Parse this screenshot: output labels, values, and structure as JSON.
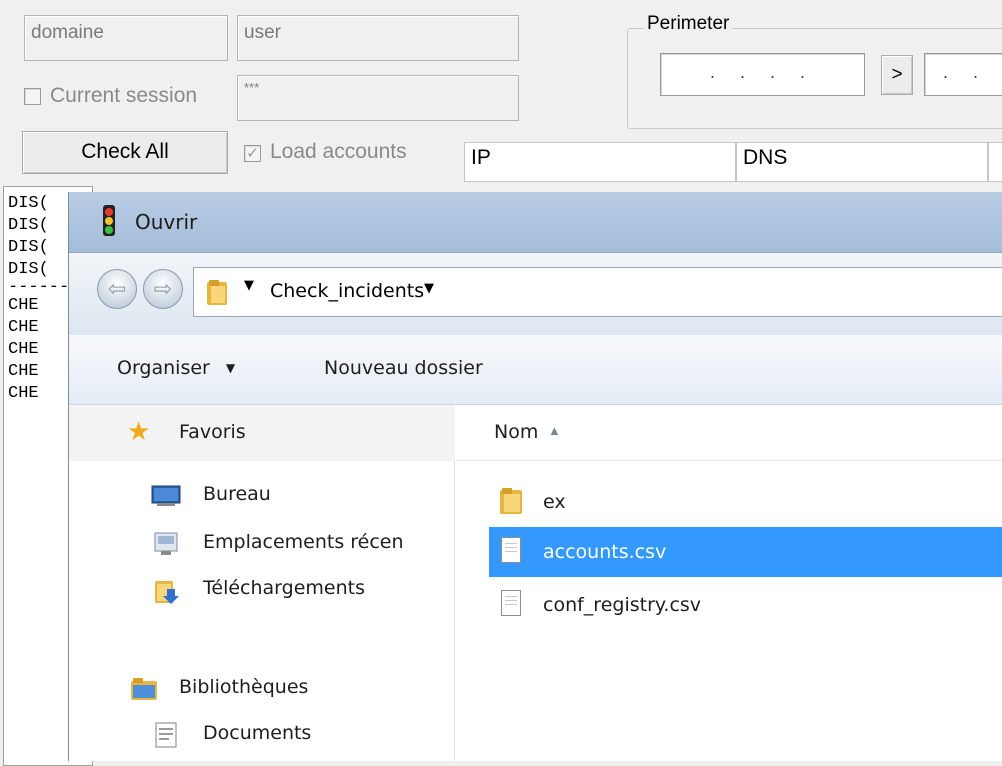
{
  "app": {
    "domain_field": "domaine",
    "user_field": "user",
    "password_field": "***",
    "current_session_label": "Current session",
    "check_all_button": "Check All",
    "load_accounts_label": "Load accounts",
    "perimeter_title": "Perimeter",
    "ip_start_value": ". . . .",
    "ip_end_value": ". .",
    "perimeter_next_button": ">",
    "columns": [
      "IP",
      "DNS"
    ],
    "log_lines": [
      "DIS(",
      "DIS(",
      "DIS(",
      "DIS(",
      "-------",
      "CHE",
      "CHE",
      "CHE",
      "CHE",
      "CHE"
    ]
  },
  "dialog": {
    "title": "Ouvrir",
    "icon": "traffic-light-icon",
    "back_glyph": "⇦",
    "forward_glyph": "⇨",
    "breadcrumb": "Check_incidents",
    "toolbar": {
      "organize": "Organiser",
      "new_folder": "Nouveau dossier"
    },
    "nav": {
      "favorites_header": "Favoris",
      "favorites": [
        {
          "label": "Bureau",
          "icon": "desktop-icon"
        },
        {
          "label": "Emplacements récen",
          "icon": "recent-places-icon"
        },
        {
          "label": "Téléchargements",
          "icon": "downloads-icon"
        }
      ],
      "libraries_header": "Bibliothèques",
      "libraries": [
        {
          "label": "Documents",
          "icon": "documents-icon"
        }
      ]
    },
    "column_header": "Nom",
    "files": [
      {
        "name": "ex",
        "type": "folder",
        "selected": false
      },
      {
        "name": "accounts.csv",
        "type": "file",
        "selected": true
      },
      {
        "name": "conf_registry.csv",
        "type": "file",
        "selected": false
      }
    ]
  },
  "colors": {
    "selection": "#3399ff",
    "titlebar": "#a4bcd8"
  }
}
